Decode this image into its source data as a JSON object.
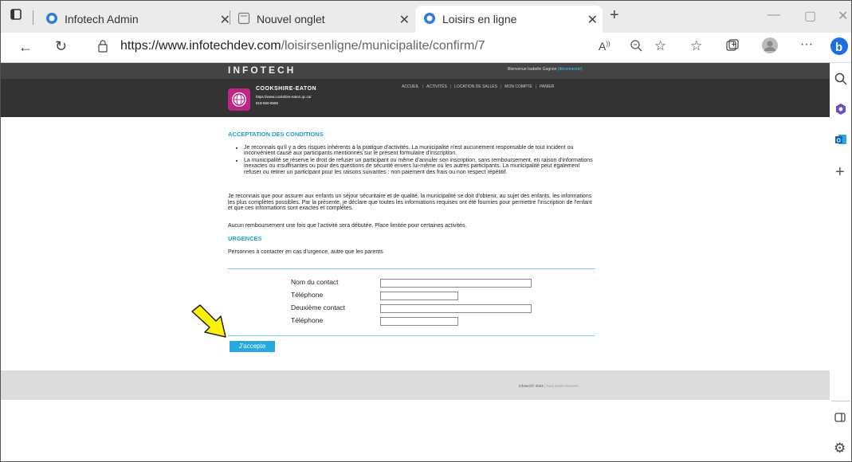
{
  "browser": {
    "tabs": [
      {
        "title": "Infotech Admin",
        "icon": "edge-favicon"
      },
      {
        "title": "Nouvel onglet",
        "icon": "new-tab-icon"
      },
      {
        "title": "Loisirs en ligne",
        "icon": "edge-favicon"
      }
    ],
    "url_domain": "https://www.infotechdev.com",
    "url_path": "/loisirsenligne/municipalite/confirm/7",
    "accent": "#0078d4"
  },
  "site": {
    "logo": "INFOTECH",
    "welcome_prefix": "Bienvenue Isabelle Gagnon",
    "logout": "(déconnecter)",
    "municipality": {
      "name": "COOKSHIRE-EATON",
      "url": "https://www.cookshire-eaton.qc.ca/",
      "phone": "819-560-8585"
    },
    "nav": [
      "ACCUEIL",
      "ACTIVITÉS",
      "LOCATION DE SALLES",
      "MON COMPTE",
      "PANIER"
    ]
  },
  "page": {
    "heading_conditions": "ACCEPTATION DES CONDITIONS",
    "conditions": [
      "Je reconnais qu'il y a des risques inhérents à la pratique d'activités. La municipalité n'est aucunement responsable de tout incident ou inconvénient causé aux participants mentionnés sur le présent formulaire d'inscription.",
      "La municipalité se réserve le droit de refuser un participant ou même d'annuler son inscription, sans remboursement, en raison d'informations inexactes ou insuffisantes ou pour des questions de sécurité envers lui-même ou les autres participants. La municipalité peut également refuser ou retirer un participant pour les raisons suivantes : non paiement des frais ou non respect répétitif."
    ],
    "paragraph": "Je reconnais que pour assurer aux enfants un séjour sécuritaire et de qualité, la municipalité se doit d'obtenir, au sujet des enfants, les informations les plus complètes possibles. Par la présente, je déclare que toutes les informations requises ont été fournies pour permettre l'inscription de l'enfant et que ces informations sont exactes et complètes.",
    "refund_note": "Aucun remboursement une fois que l'activité sera débutée. Place limitée pour certaines activités.",
    "heading_urgences": "URGENCES",
    "urgences_text": "Personnes à contacter en cas d'urgence, autre que les parents",
    "form": {
      "contact_label": "Nom du contact",
      "phone_label": "Téléphone",
      "second_label": "Deuxième contact",
      "phone2_label": "Téléphone",
      "contact_value": "",
      "phone_value": "",
      "second_value": "",
      "phone2_value": ""
    },
    "accept_button": "J'accepte"
  },
  "footer": {
    "copyright": "Infotech© 2023",
    "rights": "Tous droits réservés"
  }
}
